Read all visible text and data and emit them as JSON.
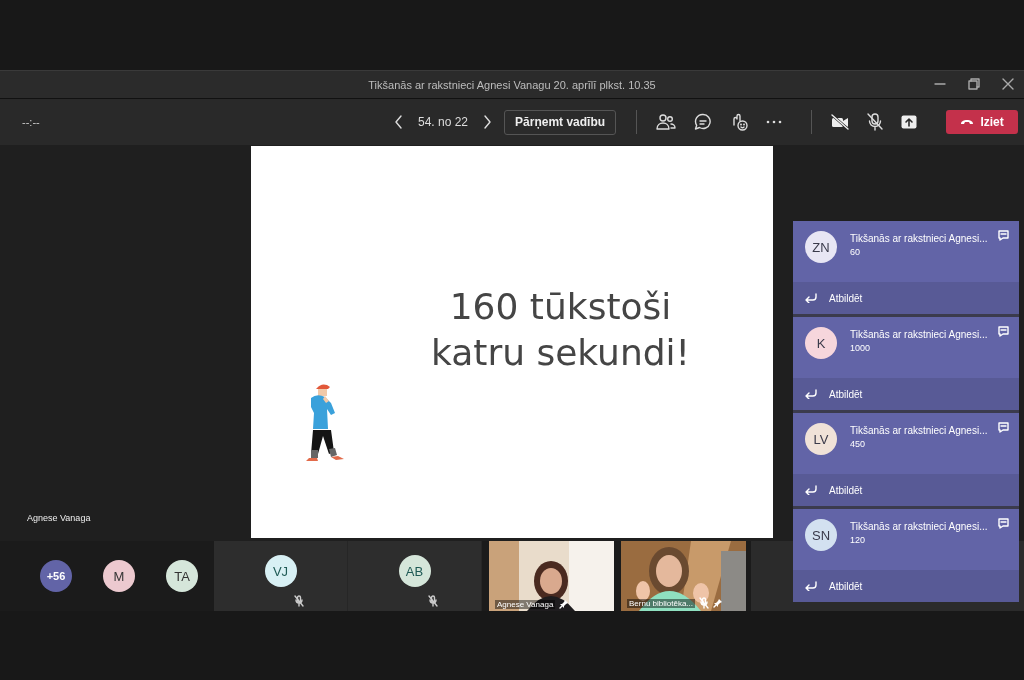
{
  "window": {
    "title": "Tikšanās ar rakstnieci Agnesi Vanagu 20. aprīlī plkst. 10.35"
  },
  "toolbar": {
    "timer": "--:--",
    "slide_counter": "54. no 22",
    "take_control": "Pārņemt vadību",
    "leave": "Iziet"
  },
  "stage": {
    "presenter_name": "Agnese Vanaga",
    "slide_lines": [
      "160 tūkstoši",
      "katru sekundi!"
    ]
  },
  "participants": [
    {
      "kind": "overflow",
      "label": "+56",
      "color": "#6264a7"
    },
    {
      "kind": "avatar",
      "label": "M",
      "color": "#ecc9cf"
    },
    {
      "kind": "avatar",
      "label": "TA",
      "color": "#d5e6da"
    },
    {
      "kind": "tile",
      "label": "VJ",
      "color": "#d8f0f4",
      "muted": true
    },
    {
      "kind": "tile",
      "label": "AB",
      "color": "#d5e6da",
      "muted": true
    },
    {
      "kind": "video",
      "name": "Agnese Vanaga",
      "muted": false,
      "pinned": true
    },
    {
      "kind": "video",
      "name": "Bernu bibliotēka...",
      "muted": true,
      "pinned": true
    },
    {
      "kind": "blank"
    }
  ],
  "notifications": [
    {
      "initials": "ZN",
      "color": "#e8e6f4",
      "title": "Tikšanās ar rakstnieci Agnesi...",
      "message": "60",
      "reply": "Atbildēt"
    },
    {
      "initials": "K",
      "color": "#f6d6dc",
      "title": "Tikšanās ar rakstnieci Agnesi...",
      "message": "1000",
      "reply": "Atbildēt"
    },
    {
      "initials": "LV",
      "color": "#f0e2d8",
      "title": "Tikšanās ar rakstnieci Agnesi...",
      "message": "450",
      "reply": "Atbildēt"
    },
    {
      "initials": "SN",
      "color": "#d3e1f0",
      "title": "Tikšanās ar rakstnieci Agnesi...",
      "message": "120",
      "reply": "Atbildēt"
    }
  ]
}
